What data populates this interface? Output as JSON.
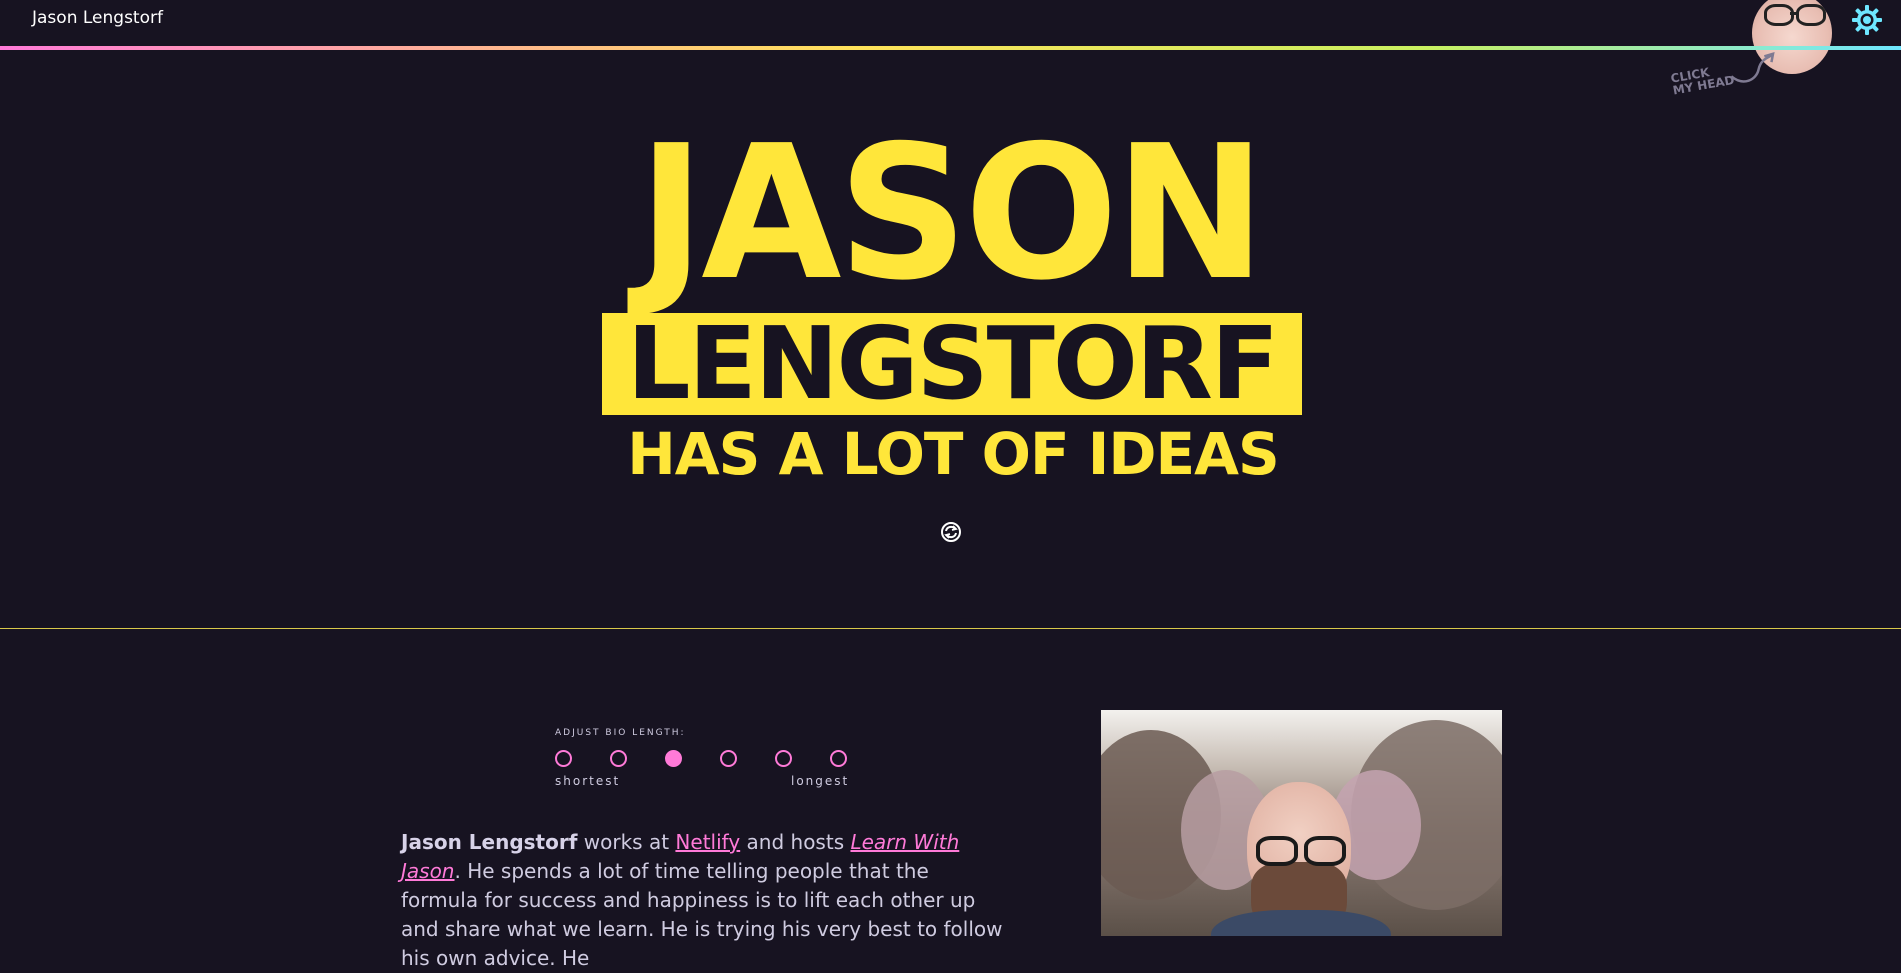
{
  "header": {
    "site_name": "Jason Lengstorf",
    "click_note": [
      "CLICK",
      "MY HEAD"
    ]
  },
  "hero": {
    "line1": "JASON",
    "line2": "LENGSTORF",
    "line3": "HAS A LOT OF IDEAS"
  },
  "bio_control": {
    "label": "ADJUST BIO LENGTH:",
    "options_count": 6,
    "selected_index": 2,
    "shortest_label": "shortest",
    "longest_label": "longest"
  },
  "bio": {
    "name": "Jason Lengstorf",
    "works_at": " works at ",
    "company": "Netlify",
    "and_hosts": " and hosts ",
    "show": "Learn With Jason",
    "period": ".",
    "rest": "He spends a lot of time telling people that the formula for success and happiness is to lift each other up and share what we learn. He is trying his very best to follow his own advice. He"
  },
  "colors": {
    "background": "#171321",
    "accent_yellow": "#ffe63a",
    "accent_pink": "#ff7ad8",
    "text": "#cfcbe0"
  },
  "icons": [
    "gear-icon",
    "refresh-icon",
    "arrow-icon"
  ]
}
